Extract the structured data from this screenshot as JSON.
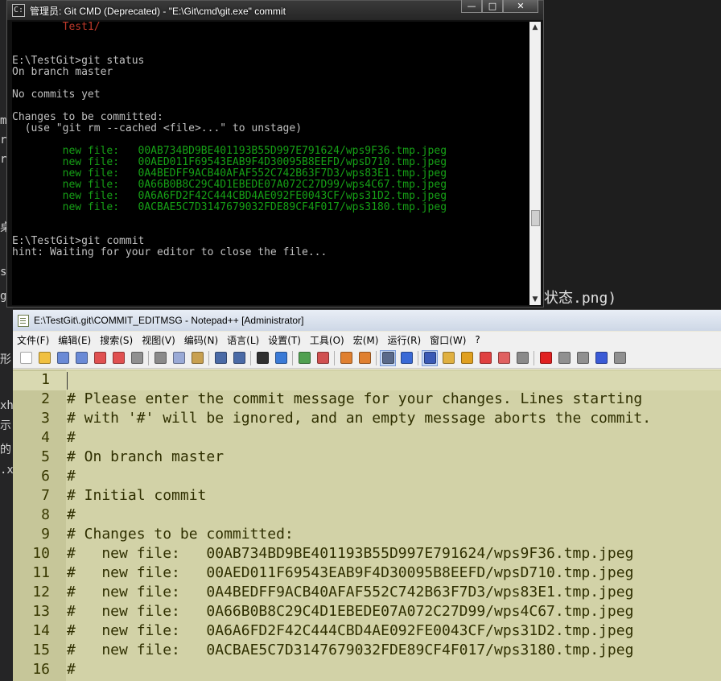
{
  "background": {
    "right_text": "状态.png)",
    "left_fragments": [
      "m",
      "r",
      "r",
      "桌",
      "s",
      "g",
      "形",
      "xh",
      "示",
      "的",
      ".x"
    ]
  },
  "cmd": {
    "title": "管理员: Git CMD (Deprecated) - \"E:\\Git\\cmd\\git.exe\"  commit",
    "icon_text": "C:",
    "buttons": {
      "minimize": "—",
      "maximize": "□",
      "close": "✕"
    },
    "lines": [
      {
        "text": "        Test1/",
        "color": "#c0392b"
      },
      {
        "text": "",
        "color": "#c0c0c0"
      },
      {
        "text": "",
        "color": "#c0c0c0"
      },
      {
        "text": "E:\\TestGit>git status",
        "color": "#c0c0c0"
      },
      {
        "text": "On branch master",
        "color": "#c0c0c0"
      },
      {
        "text": "",
        "color": "#c0c0c0"
      },
      {
        "text": "No commits yet",
        "color": "#c0c0c0"
      },
      {
        "text": "",
        "color": "#c0c0c0"
      },
      {
        "text": "Changes to be committed:",
        "color": "#c0c0c0"
      },
      {
        "text": "  (use \"git rm --cached <file>...\" to unstage)",
        "color": "#c0c0c0"
      },
      {
        "text": "",
        "color": "#c0c0c0"
      },
      {
        "text": "        new file:   00AB734BD9BE401193B55D997E791624/wps9F36.tmp.jpeg",
        "color": "#16a016"
      },
      {
        "text": "        new file:   00AED011F69543EAB9F4D30095B8EEFD/wpsD710.tmp.jpeg",
        "color": "#16a016"
      },
      {
        "text": "        new file:   0A4BEDFF9ACB40AFAF552C742B63F7D3/wps83E1.tmp.jpeg",
        "color": "#16a016"
      },
      {
        "text": "        new file:   0A66B0B8C29C4D1EBEDE07A072C27D99/wps4C67.tmp.jpeg",
        "color": "#16a016"
      },
      {
        "text": "        new file:   0A6A6FD2F42C444CBD4AE092FE0043CF/wps31D2.tmp.jpeg",
        "color": "#16a016"
      },
      {
        "text": "        new file:   0ACBAE5C7D3147679032FDE89CF4F017/wps3180.tmp.jpeg",
        "color": "#16a016"
      },
      {
        "text": "",
        "color": "#c0c0c0"
      },
      {
        "text": "",
        "color": "#c0c0c0"
      },
      {
        "text": "E:\\TestGit>git commit",
        "color": "#c0c0c0"
      },
      {
        "text": "hint: Waiting for your editor to close the file...",
        "color": "#c0c0c0"
      }
    ],
    "scroll_up": "▲",
    "scroll_down": "▼"
  },
  "npp": {
    "title": "E:\\TestGit\\.git\\COMMIT_EDITMSG - Notepad++ [Administrator]",
    "menu": [
      "文件(F)",
      "编辑(E)",
      "搜索(S)",
      "视图(V)",
      "编码(N)",
      "语言(L)",
      "设置(T)",
      "工具(O)",
      "宏(M)",
      "运行(R)",
      "窗口(W)",
      "?"
    ],
    "toolbar_icons": [
      {
        "name": "new-file-icon",
        "color": "#ffffff"
      },
      {
        "name": "open-file-icon",
        "color": "#f0c040"
      },
      {
        "name": "save-icon",
        "color": "#6a8ad6"
      },
      {
        "name": "save-all-icon",
        "color": "#6a8ad6"
      },
      {
        "name": "close-file-icon",
        "color": "#e05050"
      },
      {
        "name": "close-all-icon",
        "color": "#e05050"
      },
      {
        "name": "print-icon",
        "color": "#909090"
      },
      {
        "sep": true
      },
      {
        "name": "cut-icon",
        "color": "#8a8a8a"
      },
      {
        "name": "copy-icon",
        "color": "#9aaad6"
      },
      {
        "name": "paste-icon",
        "color": "#c8a050"
      },
      {
        "sep": true
      },
      {
        "name": "undo-icon",
        "color": "#4a6aa6"
      },
      {
        "name": "redo-icon",
        "color": "#4a6aa6"
      },
      {
        "sep": true
      },
      {
        "name": "find-icon",
        "color": "#303030"
      },
      {
        "name": "replace-icon",
        "color": "#3a7ad6"
      },
      {
        "sep": true
      },
      {
        "name": "zoom-in-icon",
        "color": "#50a050"
      },
      {
        "name": "zoom-out-icon",
        "color": "#d05050"
      },
      {
        "sep": true
      },
      {
        "name": "sync-vertical-icon",
        "color": "#e08030"
      },
      {
        "name": "sync-horizontal-icon",
        "color": "#e08030"
      },
      {
        "sep": true
      },
      {
        "name": "word-wrap-icon",
        "color": "#5a6a8a",
        "active": true
      },
      {
        "name": "show-all-chars-icon",
        "color": "#3a6ad6"
      },
      {
        "sep": true
      },
      {
        "name": "indent-guide-icon",
        "color": "#3a5ab6",
        "active": true
      },
      {
        "name": "folder-as-workspace-icon",
        "color": "#e0b040"
      },
      {
        "name": "document-map-icon",
        "color": "#e0a020"
      },
      {
        "name": "function-list-icon",
        "color": "#e04040"
      },
      {
        "name": "folder-icon",
        "color": "#e06060"
      },
      {
        "name": "monitoring-icon",
        "color": "#8a8a8a"
      },
      {
        "sep": true
      },
      {
        "name": "record-macro-icon",
        "color": "#e02020"
      },
      {
        "name": "stop-macro-icon",
        "color": "#909090"
      },
      {
        "name": "play-macro-icon",
        "color": "#909090"
      },
      {
        "name": "play-multiple-macro-icon",
        "color": "#3a5ad6"
      },
      {
        "name": "save-macro-icon",
        "color": "#909090"
      }
    ],
    "lines": [
      {
        "n": "1",
        "text": ""
      },
      {
        "n": "2",
        "text": "# Please enter the commit message for your changes. Lines starting"
      },
      {
        "n": "3",
        "text": "# with '#' will be ignored, and an empty message aborts the commit."
      },
      {
        "n": "4",
        "text": "#"
      },
      {
        "n": "5",
        "text": "# On branch master"
      },
      {
        "n": "6",
        "text": "#"
      },
      {
        "n": "7",
        "text": "# Initial commit"
      },
      {
        "n": "8",
        "text": "#"
      },
      {
        "n": "9",
        "text": "# Changes to be committed:"
      },
      {
        "n": "10",
        "text": "#   new file:   00AB734BD9BE401193B55D997E791624/wps9F36.tmp.jpeg"
      },
      {
        "n": "11",
        "text": "#   new file:   00AED011F69543EAB9F4D30095B8EEFD/wpsD710.tmp.jpeg"
      },
      {
        "n": "12",
        "text": "#   new file:   0A4BEDFF9ACB40AFAF552C742B63F7D3/wps83E1.tmp.jpeg"
      },
      {
        "n": "13",
        "text": "#   new file:   0A66B0B8C29C4D1EBEDE07A072C27D99/wps4C67.tmp.jpeg"
      },
      {
        "n": "14",
        "text": "#   new file:   0A6A6FD2F42C444CBD4AE092FE0043CF/wps31D2.tmp.jpeg"
      },
      {
        "n": "15",
        "text": "#   new file:   0ACBAE5C7D3147679032FDE89CF4F017/wps3180.tmp.jpeg"
      },
      {
        "n": "16",
        "text": "#"
      }
    ]
  }
}
